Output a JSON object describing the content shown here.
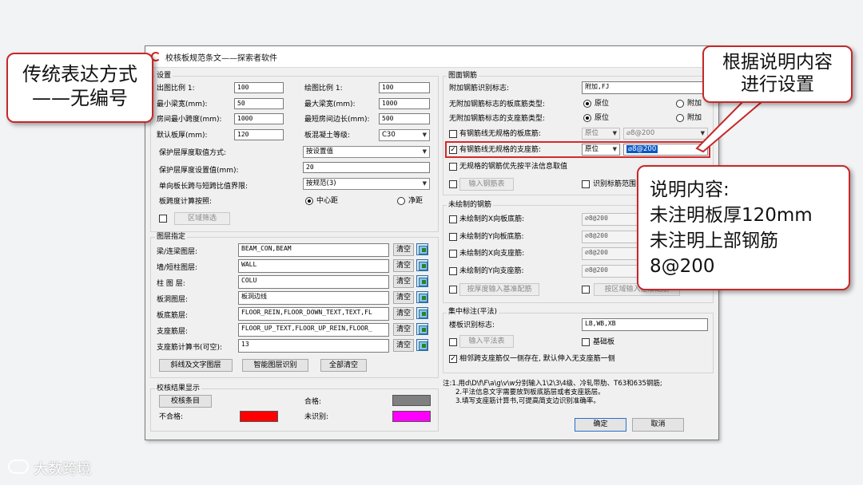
{
  "dialog": {
    "title": "校核板规范条文——探索者软件",
    "settings": {
      "title": "设置",
      "left": [
        {
          "label": "出图比例 1:",
          "value": "100"
        },
        {
          "label": "最小梁宽(mm):",
          "value": "50"
        },
        {
          "label": "房间最小跨度(mm):",
          "value": "1000"
        },
        {
          "label": "默认板厚(mm):",
          "value": "120"
        }
      ],
      "right": [
        {
          "label": "绘图比例 1:",
          "value": "100"
        },
        {
          "label": "最大梁宽(mm):",
          "value": "1000"
        },
        {
          "label": "最短房间边长(mm):",
          "value": "500"
        },
        {
          "label": "板混凝土等级:",
          "value": "C30"
        }
      ],
      "cover_method_label": "保护层厚度取值方式:",
      "cover_method_value": "按设置值",
      "cover_value_label": "保护层厚度设置值(mm):",
      "cover_value": "20",
      "ratio_label": "单向板长跨与短跨比值界限:",
      "ratio_value": "按规范(3)",
      "span_calc_label": "板跨度计算按照:",
      "span_opt1": "中心距",
      "span_opt2": "净距",
      "region_filter": "区域筛选"
    },
    "layers": {
      "title": "图层指定",
      "clear_label": "清空",
      "rows": [
        {
          "label": "梁/连梁图层:",
          "value": "BEAM_CON,BEAM"
        },
        {
          "label": "墙/短柱图层:",
          "value": "WALL"
        },
        {
          "label": "柱 图 层:",
          "value": "COLU"
        },
        {
          "label": "板洞图层:",
          "value": "板洞边线"
        },
        {
          "label": "板底筋层:",
          "value": "FLOOR_REIN,FLOOR_DOWN_TEXT,TEXT,FL"
        },
        {
          "label": "支座筋层:",
          "value": "FLOOR_UP_TEXT,FLOOR_UP_REIN,FLOOR_"
        },
        {
          "label": "支座筋计算书(可空):",
          "value": "13"
        }
      ],
      "btn_diag": "斜线及文字图层",
      "btn_smart": "智能图层识别",
      "btn_clear_all": "全部清空"
    },
    "results": {
      "title": "校核结果显示",
      "btn_items": "校核条目",
      "pass_label": "合格:",
      "fail_label": "不合格:",
      "unknown_label": "未识别:",
      "colors": {
        "pass": "#808080",
        "fail": "#ff0000",
        "unknown": "#ff00ff"
      }
    },
    "drawn_rebar": {
      "title": "图面钢筋",
      "add_mark_label": "附加钢筋识别标志:",
      "add_mark_value": "附加,FJ",
      "no_mark_bottom_label": "无附加钢筋标志的板底筋类型:",
      "no_mark_support_label": "无附加钢筋标志的支座筋类型:",
      "opt_original": "原位",
      "opt_additional": "附加",
      "row_bottom_label": "有钢筋线无规格的板底筋:",
      "row_bottom_sel": "原位",
      "row_bottom_val": "⌀8@200",
      "row_support_label": "有钢筋线无规格的支座筋:",
      "row_support_sel": "原位",
      "row_support_val": "⌀8@200",
      "priority_label": "无规格的钢筋优先按平法信息取值",
      "btn_input_table": "输入钢筋表",
      "identify_range": "识别标筋范围"
    },
    "undrawn_rebar": {
      "title": "未绘制的钢筋",
      "rows": [
        {
          "label": "未绘制的X向板底筋:",
          "value": "⌀8@200"
        },
        {
          "label": "未绘制的Y向板底筋:",
          "value": "⌀8@200"
        },
        {
          "label": "未绘制的X向支座筋:",
          "value": "⌀8@200"
        },
        {
          "label": "未绘制的Y向支座筋:",
          "value": "⌀8@200"
        }
      ],
      "btn_thickness": "按厚度输入基准配筋",
      "btn_region": "按区域输入基准配筋"
    },
    "concentrated": {
      "title": "集中标注(平法)",
      "mark_label": "楼板识别标志:",
      "mark_value": "LB,WB,XB",
      "btn_input_table": "输入平法表",
      "foundation_label": "基础板",
      "adjacent_label": "相邻跨支座筋仅一侧存在, 默认伸入无支座筋一侧"
    },
    "notes": {
      "line1": "注:1.用d\\D\\f\\F\\a\\g\\v\\w分别输入1\\2\\3\\4级、冷轧带肋、T63和635钢筋;",
      "line2": "2.平法信息文字需要放到板底筋层或者支座筋层。",
      "line3": "3.填写支座筋计算书,可提高简支边识别准确率。"
    },
    "ok": "确定",
    "cancel": "取消"
  },
  "callouts": {
    "left_line1": "传统表达方式",
    "left_line2": "——无编号",
    "top_line1": "根据说明内容",
    "top_line2": "进行设置",
    "right_line1": "说明内容:",
    "right_line2": "未注明板厚120mm",
    "right_line3": "未注明上部钢筋",
    "right_line4": "8@200"
  },
  "watermark": "大数跨境"
}
